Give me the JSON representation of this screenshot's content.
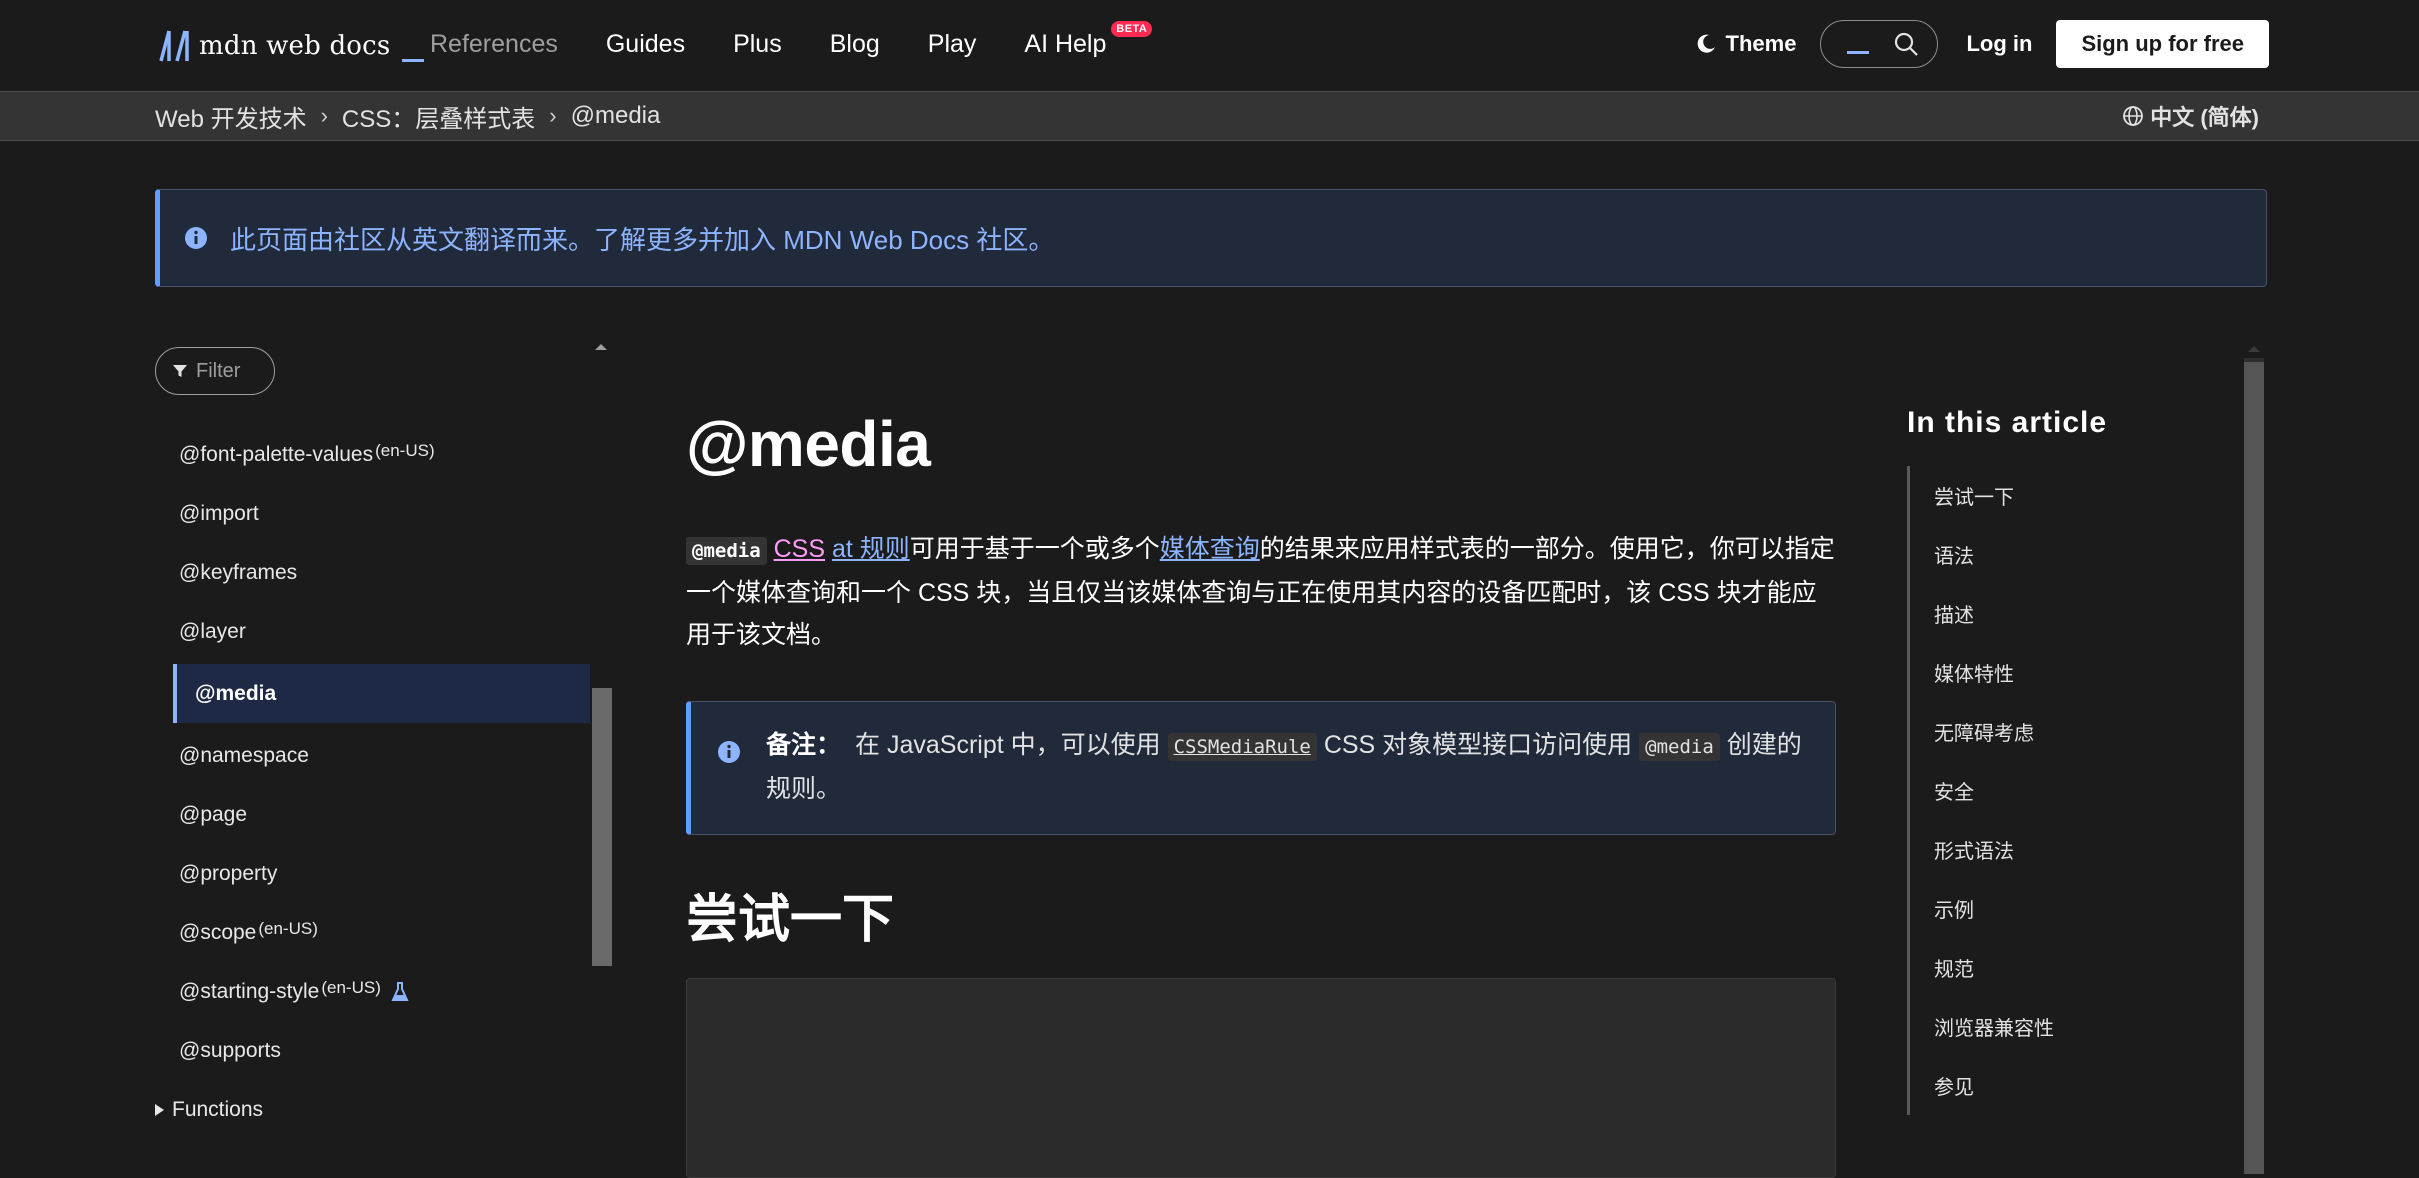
{
  "header": {
    "logo_text": "mdn web docs",
    "nav": [
      {
        "label": "References"
      },
      {
        "label": "Guides"
      },
      {
        "label": "Plus"
      },
      {
        "label": "Blog"
      },
      {
        "label": "Play"
      },
      {
        "label": "AI Help"
      }
    ],
    "beta_badge": "BETA",
    "theme_label": "Theme",
    "login_label": "Log in",
    "signup_label": "Sign up for free"
  },
  "breadcrumb": {
    "items": [
      "Web 开发技术",
      "CSS：层叠样式表",
      "@media"
    ],
    "separator": "›",
    "language": "中文 (简体)"
  },
  "notice": {
    "text": "此页面由社区从英文翻译而来。了解更多并加入 MDN Web Docs 社区。"
  },
  "sidebar": {
    "filter_placeholder": "Filter",
    "items": [
      {
        "label": "@font-palette-values",
        "sup": "(en-US)"
      },
      {
        "label": "@import"
      },
      {
        "label": "@keyframes"
      },
      {
        "label": "@layer"
      },
      {
        "label": "@media",
        "active": true
      },
      {
        "label": "@namespace"
      },
      {
        "label": "@page"
      },
      {
        "label": "@property"
      },
      {
        "label": "@scope",
        "sup": "(en-US)"
      },
      {
        "label": "@starting-style",
        "sup": "(en-US)",
        "experimental": true
      },
      {
        "label": "@supports"
      }
    ],
    "group_label": "Functions"
  },
  "article": {
    "title": "@media",
    "intro": {
      "code": "@media",
      "link1": "CSS",
      "link2": "at 规则",
      "text1": "可用于基于一个或多个",
      "link3": "媒体查询",
      "text2": "的结果来应用样式表的一部分。使用它，你可以指定一个媒体查询和一个 CSS 块，当且仅当该媒体查询与正在使用其内容的设备匹配时，该 CSS 块才能应用于该文档。"
    },
    "note": {
      "label": "备注：",
      "text1": "在 JavaScript 中，可以使用",
      "code1": "CSSMediaRule",
      "text2": "CSS 对象模型接口访问使用",
      "code2": "@media",
      "text3": "创建的规则。"
    },
    "section_title": "尝试一下"
  },
  "toc": {
    "title": "In this article",
    "items": [
      "尝试一下",
      "语法",
      "描述",
      "媒体特性",
      "无障碍考虑",
      "安全",
      "形式语法",
      "示例",
      "规范",
      "浏览器兼容性",
      "参见"
    ]
  },
  "colors": {
    "background": "#1b1b1b",
    "accent": "#8cb4ff",
    "visited_link": "#ff9bf5",
    "beta": "#ff2a51"
  }
}
